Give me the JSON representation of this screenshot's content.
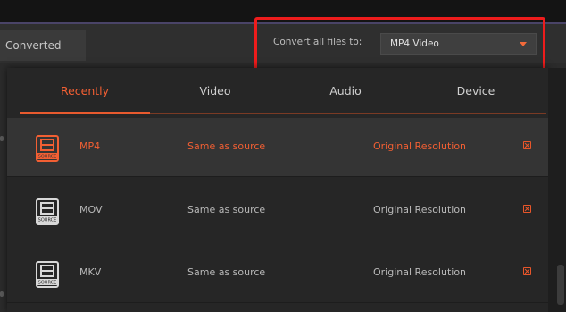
{
  "header": {
    "converted_tab": "Converted",
    "convert_all_label": "Convert all files to:",
    "selected_format": "MP4 Video"
  },
  "tabs": [
    {
      "label": "Recently",
      "active": true
    },
    {
      "label": "Video",
      "active": false
    },
    {
      "label": "Audio",
      "active": false
    },
    {
      "label": "Device",
      "active": false
    }
  ],
  "formats": [
    {
      "name": "MP4",
      "quality": "Same as source",
      "resolution": "Original Resolution",
      "selected": true
    },
    {
      "name": "MOV",
      "quality": "Same as source",
      "resolution": "Original Resolution",
      "selected": false
    },
    {
      "name": "MKV",
      "quality": "Same as source",
      "resolution": "Original Resolution",
      "selected": false
    }
  ],
  "icons": {
    "format_icon": "source-file-icon",
    "remove": "close-box-icon",
    "dropdown": "chevron-down-icon"
  },
  "colors": {
    "accent": "#f25f33",
    "highlight": "#ee1c1c"
  }
}
